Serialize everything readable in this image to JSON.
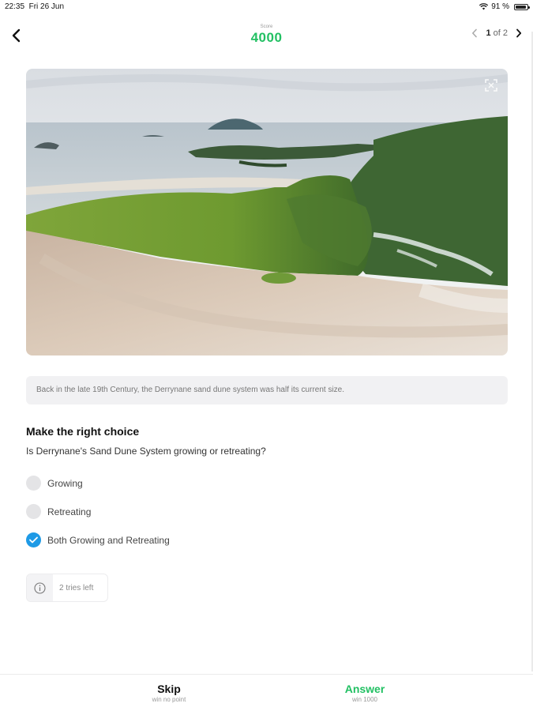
{
  "status": {
    "time": "22:35",
    "date": "Fri 26 Jun",
    "battery": "91 %"
  },
  "header": {
    "score_label": "Score",
    "score_value": "4000",
    "pager_current": "1",
    "pager_rest": "of 2"
  },
  "caption": "Back in the late 19th Century, the Derrynane sand dune system was half its current size.",
  "question": {
    "title": "Make the right choice",
    "text": "Is Derrynane's Sand Dune System growing or retreating?",
    "options": [
      {
        "label": "Growing",
        "selected": false
      },
      {
        "label": "Retreating",
        "selected": false
      },
      {
        "label": "Both Growing and Retreating",
        "selected": true
      }
    ]
  },
  "tries": "2 tries left",
  "bottom": {
    "skip_label": "Skip",
    "skip_sub": "win no point",
    "answer_label": "Answer",
    "answer_sub": "win 1000"
  },
  "colors": {
    "accent_green": "#22c063",
    "selected_blue": "#1e9ae6"
  },
  "icons": [
    "back-arrow-icon",
    "chevron-left-icon",
    "chevron-right-icon",
    "expand-icon",
    "info-icon",
    "checkmark-icon",
    "wifi-icon",
    "battery-icon"
  ]
}
